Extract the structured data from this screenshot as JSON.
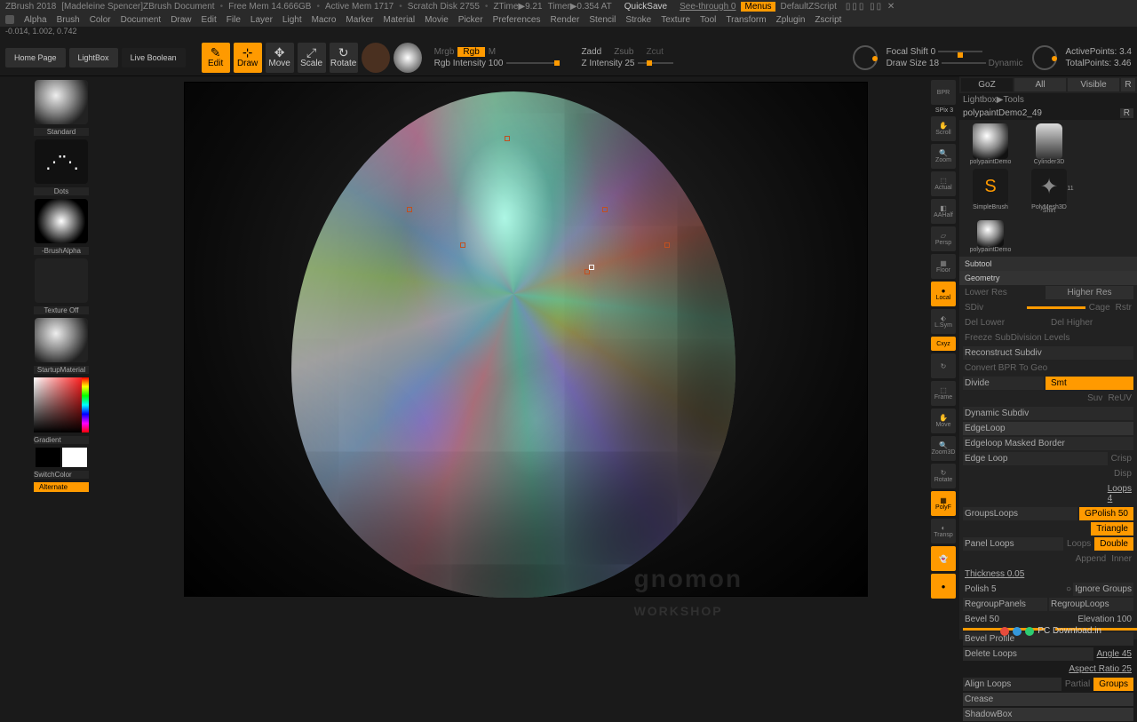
{
  "titlebar": {
    "app": "ZBrush 2018",
    "doc": "[Madeleine Spencer]ZBrush Document",
    "freemem": "Free Mem 14.666GB",
    "activemem": "Active Mem 1717",
    "scratch": "Scratch Disk 2755",
    "ztime": "ZTime▶9.21",
    "timer": "Timer▶0.354 AT",
    "quicksave": "QuickSave",
    "seethrough": "See-through  0",
    "menus": "Menus",
    "zscript": "DefaultZScript"
  },
  "menu": [
    "Alpha",
    "Brush",
    "Color",
    "Document",
    "Draw",
    "Edit",
    "File",
    "Layer",
    "Light",
    "Macro",
    "Marker",
    "Material",
    "Movie",
    "Picker",
    "Preferences",
    "Render",
    "Stencil",
    "Stroke",
    "Texture",
    "Tool",
    "Transform",
    "Zplugin",
    "Zscript"
  ],
  "coords": "-0.014, 1.002, 0.742",
  "toptabs": {
    "home": "Home Page",
    "lightbox": "LightBox",
    "liveboolean": "Live Boolean"
  },
  "tools": {
    "edit": "Edit",
    "draw": "Draw",
    "move": "Move",
    "scale": "Scale",
    "rotate": "Rotate"
  },
  "rgb": {
    "mrgb": "Mrgb",
    "rgb": "Rgb",
    "m": "M",
    "intensity": "Rgb Intensity 100",
    "zadd": "Zadd",
    "zsub": "Zsub",
    "zcut": "Zcut",
    "zintensity": "Z Intensity 25"
  },
  "focal": {
    "shift": "Focal Shift 0",
    "drawsize": "Draw Size 18",
    "dynamic": "Dynamic",
    "activepoints": "ActivePoints: 3.4",
    "totalpoints": "TotalPoints: 3.46"
  },
  "left": {
    "brush": "Standard",
    "stroke": "Dots",
    "alpha": "-BrushAlpha",
    "texture": "Texture Off",
    "material": "StartupMaterial",
    "gradient": "Gradient",
    "switchcolor": "SwitchColor",
    "alternate": "Alternate"
  },
  "iconcol": {
    "bpr": "BPR",
    "spix": "SPix 3",
    "scroll": "Scroll",
    "zoom": "Zoom",
    "actual": "Actual",
    "aahalf": "AAHalf",
    "persp": "Persp",
    "floor": "Floor",
    "local": "Local",
    "lsym": "L.Sym",
    "xyz": "Cxyz",
    "frame": "Frame",
    "move": "Move",
    "zoom3d": "Zoom3D",
    "rotate": "Rotate",
    "polyf": "PolyF",
    "transp": "Transp"
  },
  "right": {
    "top": {
      "goz": "GoZ",
      "all": "All",
      "visible": "Visible",
      "r": "R"
    },
    "path": "Lightbox▶Tools",
    "toolname": "polypaintDemo2_49",
    "tools": [
      "polypaintDemo",
      "Cylinder3D",
      "SimpleBrush",
      "PolyMesh3D",
      "polypaintDemo",
      "Shirt"
    ],
    "count11": "11",
    "subtool": "Subtool",
    "geometry": "Geometry",
    "lowerres": "Lower Res",
    "higherres": "Higher Res",
    "sdiv": "SDiv",
    "cage": "Cage",
    "rstr": "Rstr",
    "dellower": "Del Lower",
    "delhigher": "Del Higher",
    "freeze": "Freeze SubDivision Levels",
    "reconstruct": "Reconstruct Subdiv",
    "convertbpr": "Convert BPR To Geo",
    "divide": "Divide",
    "smt": "Smt",
    "suv": "Suv",
    "reuv": "ReUV",
    "dynsubdiv": "Dynamic Subdiv",
    "edgeloop": "EdgeLoop",
    "edgeloopmask": "Edgeloop Masked Border",
    "edgeloopbtn": "Edge Loop",
    "crisp": "Crisp",
    "disp": "Disp",
    "loops4": "Loops 4",
    "groupsloops": "GroupsLoops",
    "gpolish": "GPolish 50",
    "triangle": "Triangle",
    "panelloops": "Panel Loops",
    "loops": "Loops",
    "double": "Double",
    "append": "Append",
    "inner": "Inner",
    "thickness": "Thickness 0.05",
    "polish5": "Polish 5",
    "ignoregroups": "Ignore Groups",
    "regrouppanels": "RegroupPanels",
    "regrouploops": "RegroupLoops",
    "bevel": "Bevel 50",
    "elevation": "Elevation 100",
    "bevelprofile": "Bevel Profile",
    "deleteloops": "Delete Loops",
    "angle": "Angle 45",
    "aspectratio": "Aspect Ratio 25",
    "alignloops": "Align Loops",
    "partial": "Partial",
    "groups": "Groups",
    "crease": "Crease",
    "shadowbox": "ShadowBox"
  },
  "footer": {
    "pcdl": "PC Download.in"
  }
}
